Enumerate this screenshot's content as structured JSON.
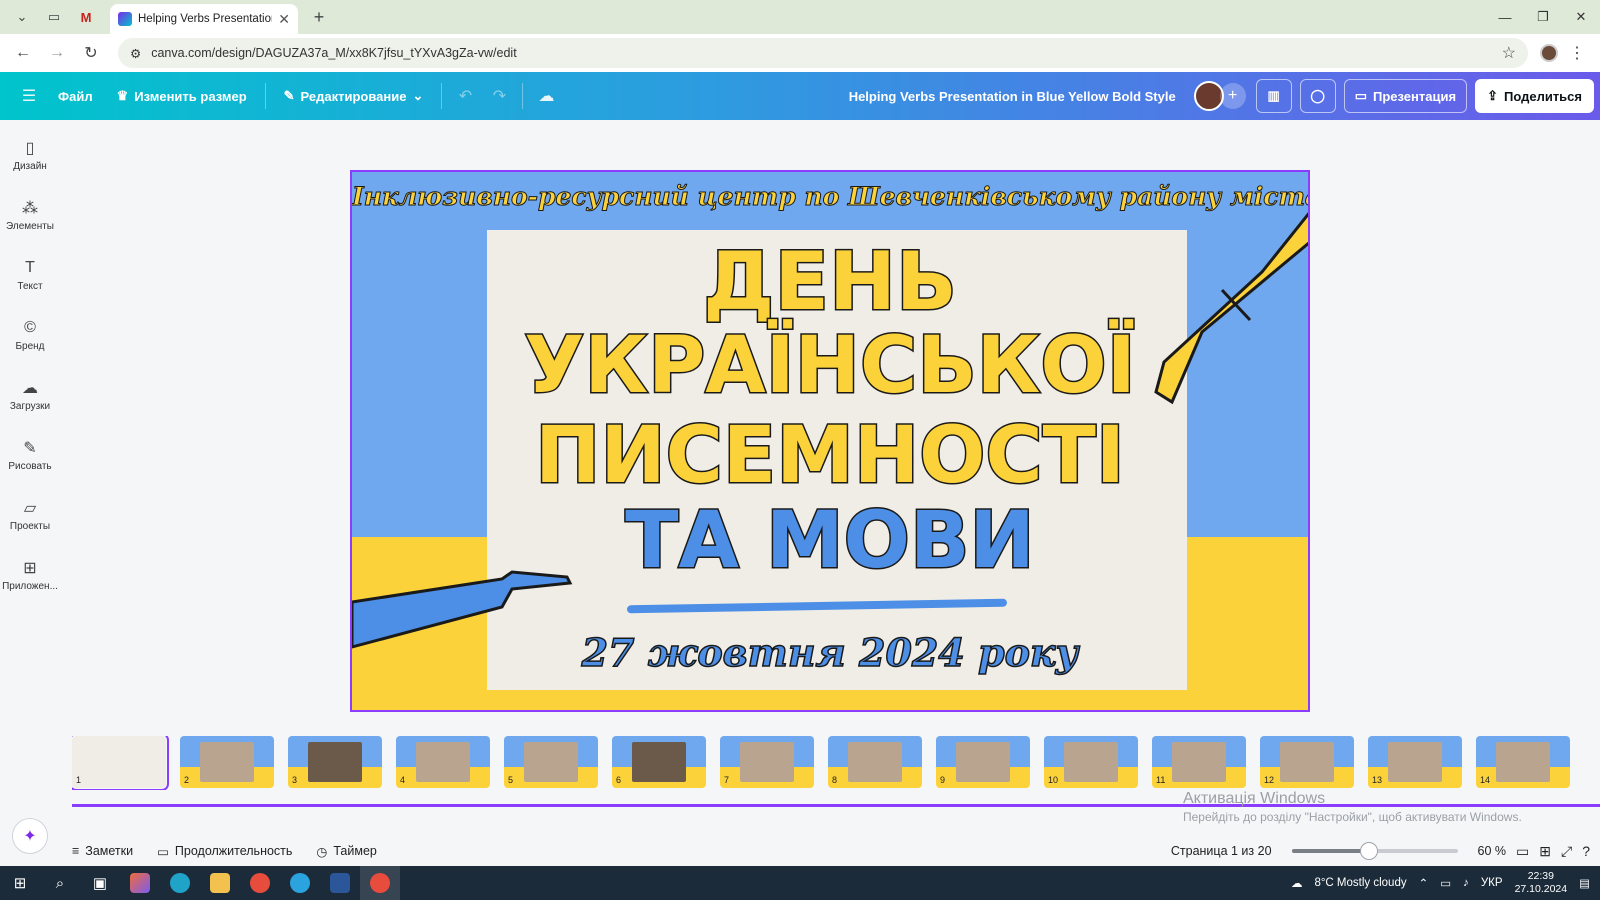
{
  "browser": {
    "tab_title": "Helping Verbs Presentation in B",
    "url": "canva.com/design/DAGUZA37a_M/xx8K7jfsu_tYXvA3gZa-vw/edit"
  },
  "toolbar": {
    "file": "Файл",
    "resize": "Изменить размер",
    "editing": "Редактирование",
    "design_title": "Helping Verbs Presentation in Blue Yellow Bold Style",
    "present": "Презентация",
    "share": "Поделиться"
  },
  "sidebar": {
    "items": [
      {
        "label": "Дизайн",
        "icon": "layout-icon"
      },
      {
        "label": "Элементы",
        "icon": "shapes-icon"
      },
      {
        "label": "Текст",
        "icon": "text-icon"
      },
      {
        "label": "Бренд",
        "icon": "brand-icon"
      },
      {
        "label": "Загрузки",
        "icon": "cloud-upload-icon"
      },
      {
        "label": "Рисовать",
        "icon": "pen-icon"
      },
      {
        "label": "Проекты",
        "icon": "folder-icon"
      },
      {
        "label": "Приложен...",
        "icon": "apps-icon"
      }
    ]
  },
  "slide": {
    "top_text": "Інклюзивно-ресурсний центр по Шевченківському району міста Запоріжжя",
    "line1": "ДЕНЬ",
    "line2": "УКРАЇНСЬКОЇ",
    "line3": "ПИСЕМНОСТІ",
    "line4": "ТА  МОВИ",
    "date": "27 жовтня 2024 року",
    "colors": {
      "blue": "#6fa8ef",
      "yellow": "#fcd23b",
      "paper": "#f0ede6",
      "accent_blue": "#4d8fe6"
    }
  },
  "thumbnails": [
    "1",
    "2",
    "3",
    "4",
    "5",
    "6",
    "7",
    "8",
    "9",
    "10",
    "11",
    "12",
    "13",
    "14"
  ],
  "watermark": {
    "title": "Активація Windows",
    "subtitle": "Перейдіть до розділу \"Настройки\", щоб активувати Windows."
  },
  "footer": {
    "notes": "Заметки",
    "duration": "Продолжительность",
    "timer": "Таймер",
    "page": "Страница 1 из 20",
    "zoom": "60 %",
    "zoom_level": 0.6
  },
  "taskbar": {
    "weather": "8°C  Mostly cloudy",
    "lang": "УКР",
    "time": "22:39",
    "date": "27.10.2024"
  }
}
